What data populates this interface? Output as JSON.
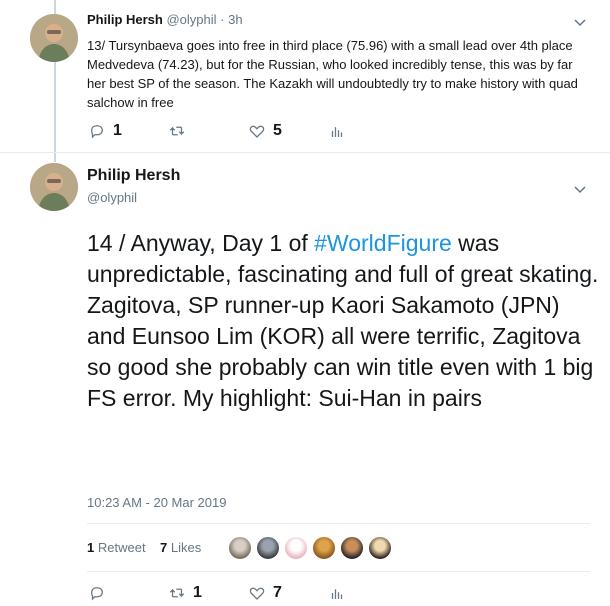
{
  "tweet1": {
    "name": "Philip Hersh",
    "handle": "@olyphil",
    "separator": "·",
    "time": "3h",
    "text": "13/ Tursynbaeva goes into free in third place (75.96) with a small lead over 4th place Medvedeva (74.23), but for the Russian, who looked incredibly tense, this was by far her best SP of the season.  The Kazakh will undoubtedly try to make history with quad salchow in free",
    "reply_count": "1",
    "retweet_count": "",
    "like_count": "5"
  },
  "tweet2": {
    "name": "Philip Hersh",
    "handle": "@olyphil",
    "text_before": "14 / Anyway, Day 1 of ",
    "hashtag": "#WorldFigure",
    "text_after": " was unpredictable, fascinating and full of great skating.  Zagitova, SP runner-up Kaori Sakamoto (JPN) and Eunsoo Lim (KOR) all were terrific, Zagitova so good she probably can win title even with 1 big FS error. My highlight: Sui-Han in pairs",
    "timestamp": "10:23 AM - 20 Mar 2019",
    "retweets_num": "1",
    "retweets_label": "Retweet",
    "likes_num": "7",
    "likes_label": "Likes",
    "reply_count": "",
    "retweet_count": "1",
    "like_count": "7"
  },
  "icons": [
    "reply-icon",
    "retweet-icon",
    "like-icon",
    "analytics-icon",
    "chevron-down-icon"
  ],
  "colors": {
    "link": "#1b95e0",
    "secondary": "#657786",
    "divider": "#e6ecf0"
  }
}
